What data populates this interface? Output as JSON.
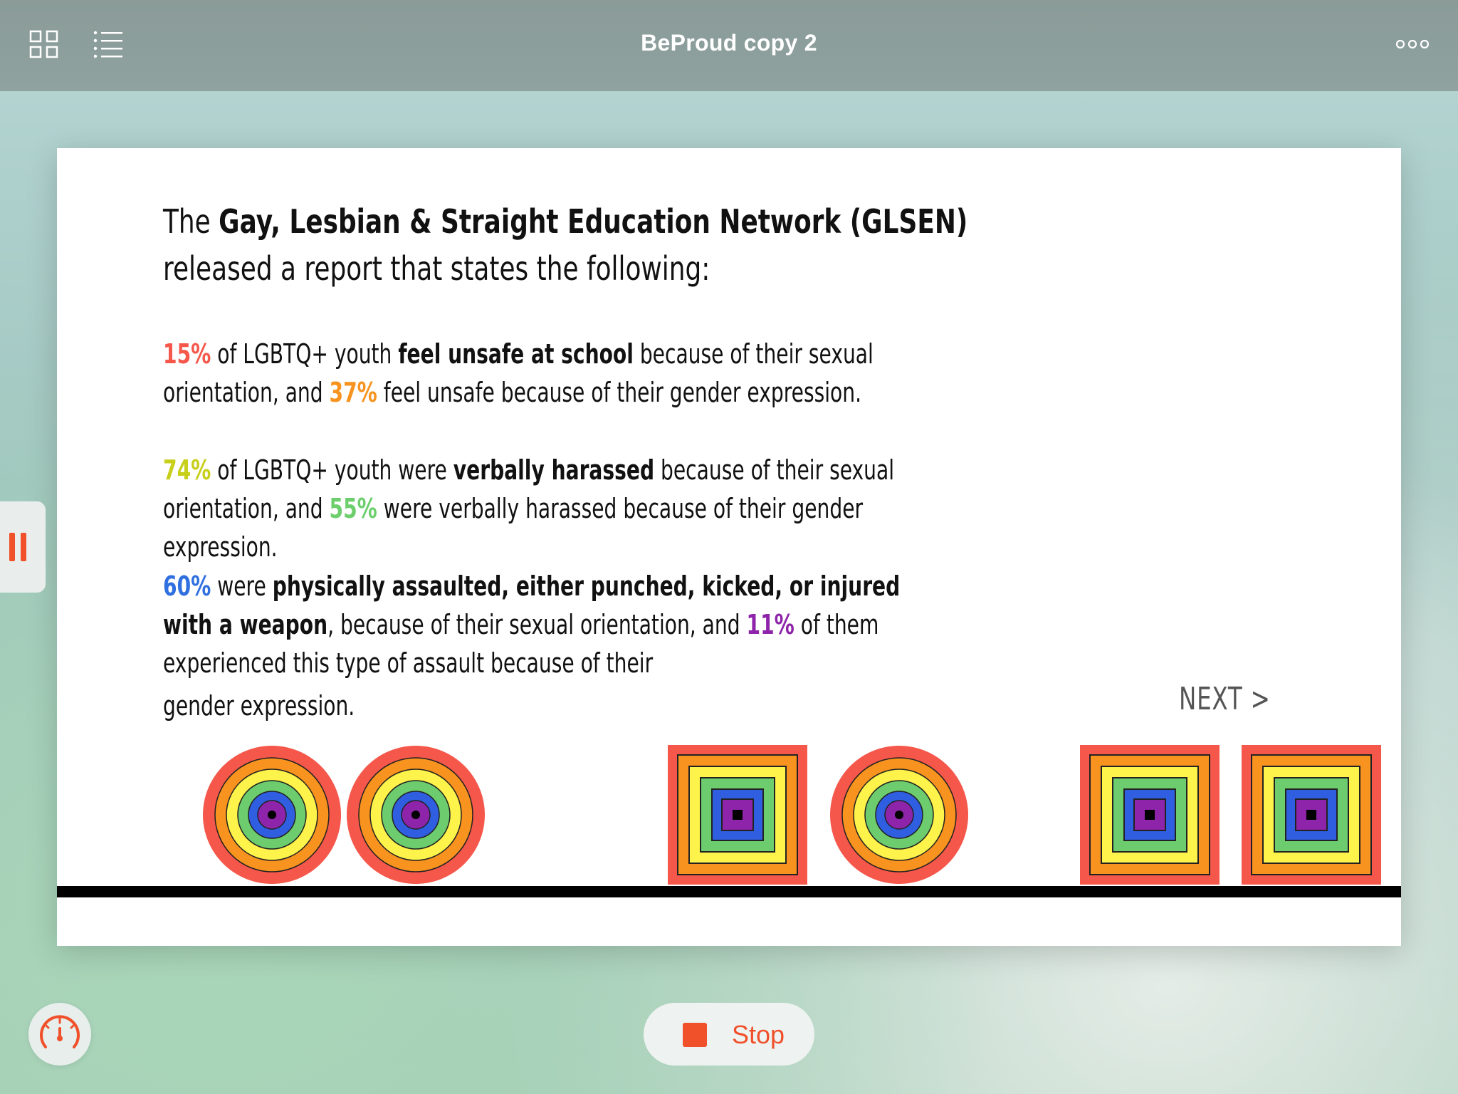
{
  "app": {
    "title": "BeProud copy 2"
  },
  "topbar": {
    "left_icons": [
      "grid-icon",
      "list-icon"
    ],
    "right_icons": [
      "more-icon"
    ]
  },
  "slide": {
    "heading": {
      "prefix": "The ",
      "org_bold": "Gay, Lesbian & Straight Education Network (GLSEN)",
      "suffix": " released a report that states the following:"
    },
    "stat1": {
      "pct_a": "15%",
      "text_a": " of LGBTQ+ youth ",
      "bold": "feel unsafe at school",
      "text_b": " because of their sexual orientation, and ",
      "pct_b": "37%",
      "text_c": " feel unsafe because of their gender expression."
    },
    "stat2": {
      "pct_a": "74%",
      "text_a": " of LGBTQ+ youth were ",
      "bold": "verbally harassed",
      "text_b": " because of their sexual orientation, and ",
      "pct_b": "55%",
      "text_c": " were verbally harassed because of their gender expression."
    },
    "stat3": {
      "pct_a": "60%",
      "text_a": " were ",
      "bold": "physically assaulted, either punched, kicked, or injured with a weapon",
      "text_b": ", because of their sexual orientation, and ",
      "pct_b": "11%",
      "text_c": " of them experienced this type of assault because of their",
      "text_d": "gender expression."
    },
    "next_label": "NEXT >",
    "shapes": [
      "circle",
      "circle",
      "square",
      "circle",
      "square",
      "square"
    ]
  },
  "colors": {
    "red": "#f5574b",
    "orange": "#f7931e",
    "yellow_green": "#c7cf1a",
    "green": "#6ccf6c",
    "blue": "#2f6fe0",
    "purple": "#8e24aa",
    "accent": "#f0502a",
    "rings": [
      "#f5574b",
      "#f7931e",
      "#fdf34a",
      "#6dcc6d",
      "#2f5fe0",
      "#8e24aa",
      "#000000"
    ]
  },
  "controls": {
    "pause_icon": "pause-icon",
    "gauge_icon": "speedometer-icon",
    "stop_label": "Stop",
    "stop_icon": "stop-square-icon"
  }
}
